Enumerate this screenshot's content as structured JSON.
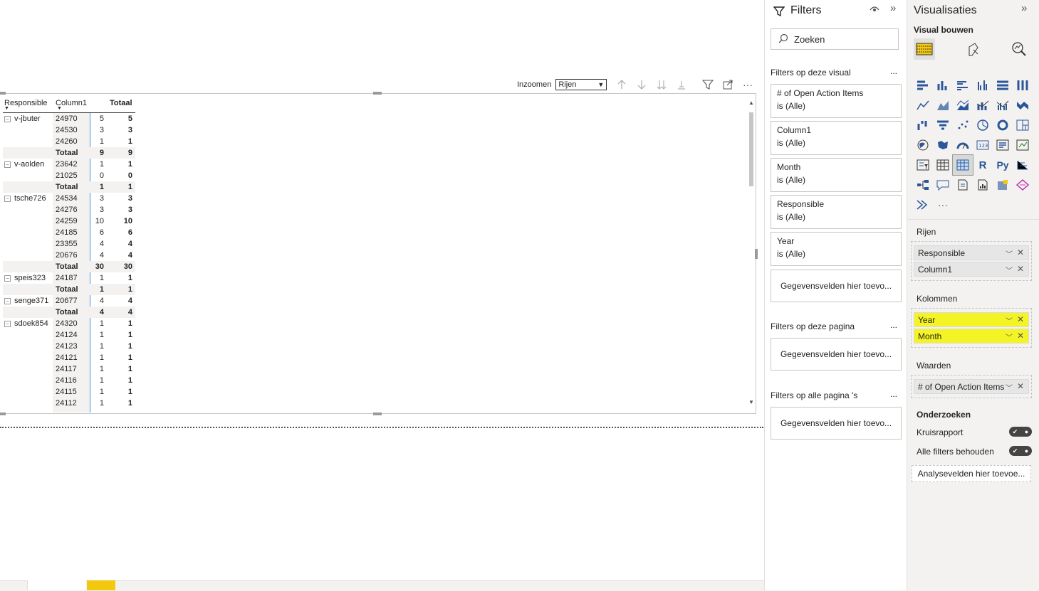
{
  "zoom": {
    "label": "Inzoomen",
    "selected": "Rijen"
  },
  "matrix": {
    "headers": {
      "responsible": "Responsible",
      "column1": "Column1",
      "total": "Totaal"
    },
    "rows": [
      {
        "resp": "v-jbuter",
        "col1": "24970",
        "v1": "5",
        "vt": "5",
        "total": false
      },
      {
        "resp": "",
        "col1": "24530",
        "v1": "3",
        "vt": "3",
        "total": false
      },
      {
        "resp": "",
        "col1": "24260",
        "v1": "1",
        "vt": "1",
        "total": false
      },
      {
        "resp": "",
        "col1": "Totaal",
        "v1": "9",
        "vt": "9",
        "total": true
      },
      {
        "resp": "v-aolden",
        "col1": "23642",
        "v1": "1",
        "vt": "1",
        "total": false
      },
      {
        "resp": "",
        "col1": "21025",
        "v1": "0",
        "vt": "0",
        "total": false
      },
      {
        "resp": "",
        "col1": "Totaal",
        "v1": "1",
        "vt": "1",
        "total": true
      },
      {
        "resp": "tsche726",
        "col1": "24534",
        "v1": "3",
        "vt": "3",
        "total": false
      },
      {
        "resp": "",
        "col1": "24276",
        "v1": "3",
        "vt": "3",
        "total": false
      },
      {
        "resp": "",
        "col1": "24259",
        "v1": "10",
        "vt": "10",
        "total": false
      },
      {
        "resp": "",
        "col1": "24185",
        "v1": "6",
        "vt": "6",
        "total": false
      },
      {
        "resp": "",
        "col1": "23355",
        "v1": "4",
        "vt": "4",
        "total": false
      },
      {
        "resp": "",
        "col1": "20676",
        "v1": "4",
        "vt": "4",
        "total": false
      },
      {
        "resp": "",
        "col1": "Totaal",
        "v1": "30",
        "vt": "30",
        "total": true
      },
      {
        "resp": "speis323",
        "col1": "24187",
        "v1": "1",
        "vt": "1",
        "total": false
      },
      {
        "resp": "",
        "col1": "Totaal",
        "v1": "1",
        "vt": "1",
        "total": true
      },
      {
        "resp": "senge371",
        "col1": "20677",
        "v1": "4",
        "vt": "4",
        "total": false
      },
      {
        "resp": "",
        "col1": "Totaal",
        "v1": "4",
        "vt": "4",
        "total": true
      },
      {
        "resp": "sdoek854",
        "col1": "24320",
        "v1": "1",
        "vt": "1",
        "total": false
      },
      {
        "resp": "",
        "col1": "24124",
        "v1": "1",
        "vt": "1",
        "total": false
      },
      {
        "resp": "",
        "col1": "24123",
        "v1": "1",
        "vt": "1",
        "total": false
      },
      {
        "resp": "",
        "col1": "24121",
        "v1": "1",
        "vt": "1",
        "total": false
      },
      {
        "resp": "",
        "col1": "24117",
        "v1": "1",
        "vt": "1",
        "total": false
      },
      {
        "resp": "",
        "col1": "24116",
        "v1": "1",
        "vt": "1",
        "total": false
      },
      {
        "resp": "",
        "col1": "24115",
        "v1": "1",
        "vt": "1",
        "total": false
      },
      {
        "resp": "",
        "col1": "24112",
        "v1": "1",
        "vt": "1",
        "total": false
      }
    ]
  },
  "filters": {
    "title": "Filters",
    "search_placeholder": "Zoeken",
    "section_visual": "Filters op deze visual",
    "cards": [
      {
        "name": "# of Open Action Items",
        "value": "is (Alle)"
      },
      {
        "name": "Column1",
        "value": "is (Alle)"
      },
      {
        "name": "Month",
        "value": "is (Alle)"
      },
      {
        "name": "Responsible",
        "value": "is (Alle)"
      },
      {
        "name": "Year",
        "value": "is (Alle)"
      }
    ],
    "add_fields": "Gegevensvelden hier toevo...",
    "section_page": "Filters op deze pagina",
    "section_all": "Filters op alle pagina 's",
    "more": "..."
  },
  "visualizations": {
    "title": "Visualisaties",
    "subtitle": "Visual bouwen",
    "rows_label": "Rijen",
    "rows": [
      "Responsible",
      "Column1"
    ],
    "columns_label": "Kolommen",
    "columns": [
      "Year",
      "Month"
    ],
    "values_label": "Waarden",
    "values": [
      "# of Open Action Items"
    ],
    "drill_label": "Onderzoeken",
    "cross_report": "Kruisrapport",
    "keep_filters": "Alle filters behouden",
    "analysis_fields": "Analysevelden hier toevoe..."
  }
}
